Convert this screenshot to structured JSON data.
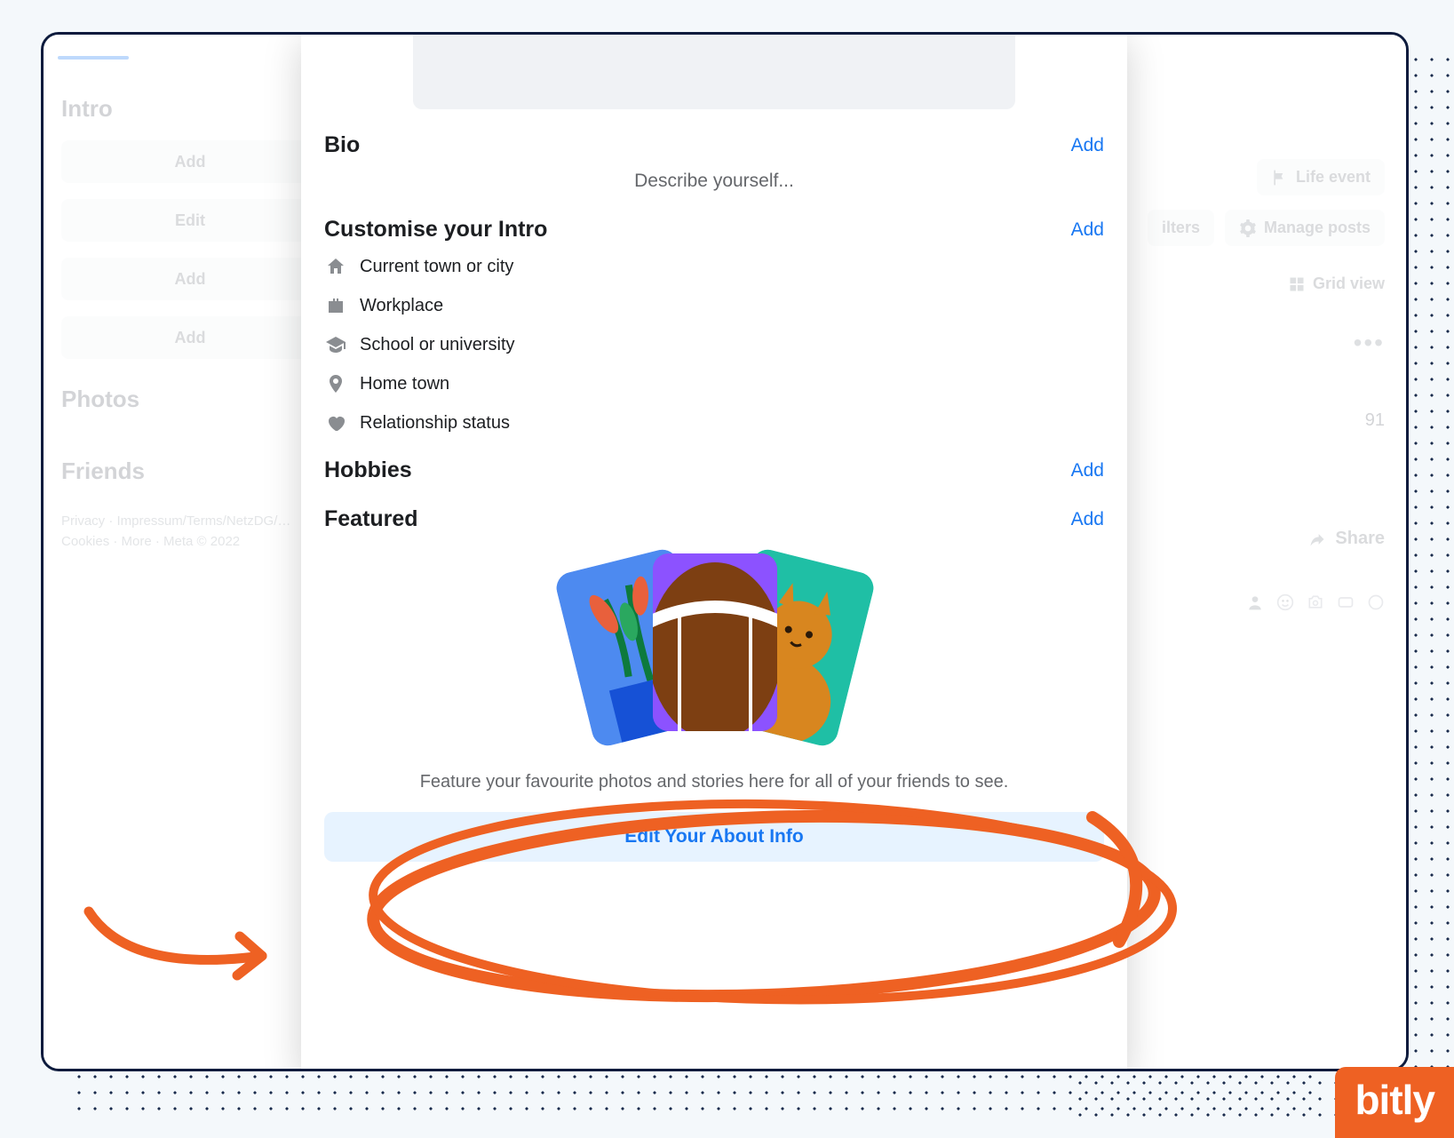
{
  "sidebar": {
    "intro_heading": "Intro",
    "pill1": "Add",
    "pill2": "Edit",
    "pill3": "Add",
    "pill4": "Add",
    "photos_heading": "Photos",
    "friends_heading": "Friends",
    "footer": "Privacy · Impressum/Terms/NetzDG/… Cookies · More · Meta © 2022"
  },
  "rightcol": {
    "life_event": "Life event",
    "filters": "ilters",
    "manage_posts": "Manage posts",
    "grid_view": "Grid view",
    "number_fragment": "91",
    "share": "Share"
  },
  "modal": {
    "bio": {
      "heading": "Bio",
      "add": "Add",
      "placeholder": "Describe yourself..."
    },
    "customise": {
      "heading": "Customise your Intro",
      "add": "Add",
      "items": [
        "Current town or city",
        "Workplace",
        "School or university",
        "Home town",
        "Relationship status"
      ]
    },
    "hobbies": {
      "heading": "Hobbies",
      "add": "Add"
    },
    "featured": {
      "heading": "Featured",
      "add": "Add",
      "caption": "Feature your favourite photos and stories here for all of your friends to see.",
      "button": "Edit Your About Info"
    }
  },
  "brand": "bitly"
}
